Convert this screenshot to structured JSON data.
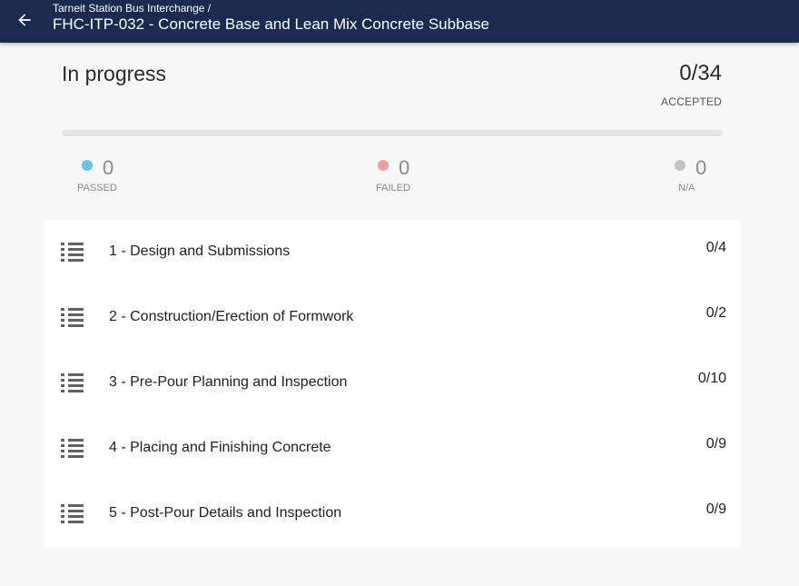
{
  "header": {
    "breadcrumb": "Tarneit Station Bus Interchange /",
    "title": "FHC-ITP-032 - Concrete Base and Lean Mix Concrete Subbase",
    "back_icon": "arrow-left-icon",
    "background_color": "#1b2b4f"
  },
  "summary": {
    "status": "In progress",
    "accepted_count": "0/34",
    "accepted_label": "ACCEPTED",
    "progress_fraction": 0
  },
  "stats": {
    "passed": {
      "value": "0",
      "label": "PASSED",
      "color": "#6bc1e8"
    },
    "failed": {
      "value": "0",
      "label": "FAILED",
      "color": "#f29ba3"
    },
    "na": {
      "value": "0",
      "label": "N/A",
      "color": "#c4c4c4"
    }
  },
  "sections": [
    {
      "label": "1 - Design and Submissions",
      "count": "0/4",
      "icon": "list-icon"
    },
    {
      "label": "2 - Construction/Erection of Formwork",
      "count": "0/2",
      "icon": "list-icon"
    },
    {
      "label": "3 - Pre-Pour Planning and Inspection",
      "count": "0/10",
      "icon": "list-icon"
    },
    {
      "label": "4 - Placing and Finishing Concrete",
      "count": "0/9",
      "icon": "list-icon"
    },
    {
      "label": "5 - Post-Pour Details and Inspection",
      "count": "0/9",
      "icon": "list-icon"
    }
  ]
}
